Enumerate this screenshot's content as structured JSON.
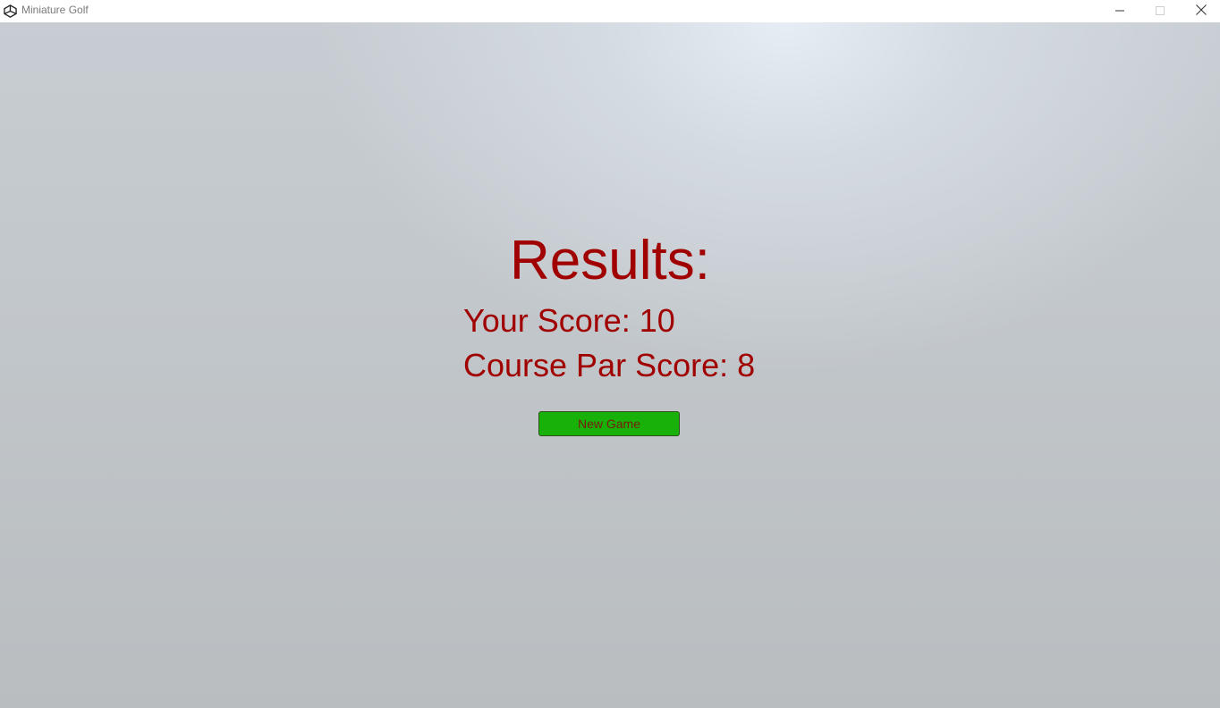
{
  "window": {
    "title": "Miniature Golf",
    "app_icon": "unity-icon",
    "controls": {
      "minimize_icon": "minimize-icon",
      "maximize_icon": "maximize-icon",
      "close_icon": "close-icon"
    }
  },
  "results": {
    "heading": "Results:",
    "your_score_text": "Your Score: 10",
    "course_par_text": "Course Par Score: 8",
    "new_game_label": "New Game"
  },
  "colors": {
    "text_red": "#a00000",
    "button_green": "#17b10a",
    "button_text": "#7a1a0a"
  }
}
